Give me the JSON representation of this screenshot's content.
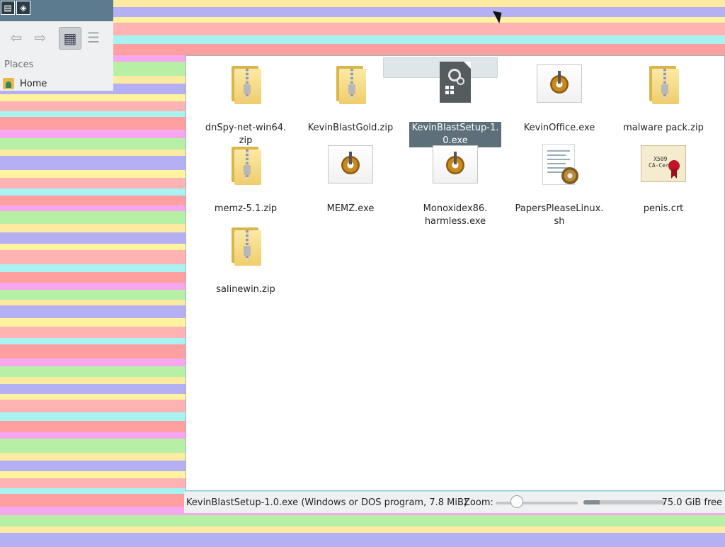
{
  "colors": {
    "stripes": [
      "#fbea9f",
      "#ffb3b3",
      "#f7a6f0",
      "#b5b0f3",
      "#a8f2f2",
      "#b6f0a5",
      "#fff3a0",
      "#ff9fa0"
    ]
  },
  "sidebar": {
    "places_label": "Places",
    "items": [
      {
        "label": "Home",
        "icon": "home-folder-icon"
      }
    ]
  },
  "toolbar": {
    "buttons": [
      {
        "name": "back",
        "icon": "arrow-left-icon"
      },
      {
        "name": "forward",
        "icon": "arrow-right-icon"
      },
      {
        "name": "icons-view",
        "icon": "icons-view-icon",
        "active": true
      },
      {
        "name": "details-view",
        "icon": "details-view-icon"
      }
    ]
  },
  "files": [
    {
      "name": "dnSpy-net-win64.\nzip",
      "type": "zip"
    },
    {
      "name": "KevinBlastGold.zip",
      "type": "zip"
    },
    {
      "name": "KevinBlastSetup-1.\n0.exe",
      "type": "setup",
      "selected": true
    },
    {
      "name": "KevinOffice.exe",
      "type": "exe"
    },
    {
      "name": "malware pack.zip",
      "type": "zip"
    },
    {
      "name": "memz-5.1.zip",
      "type": "zip"
    },
    {
      "name": "MEMZ.exe",
      "type": "exe"
    },
    {
      "name": "Monoxidex86.\nharmless.exe",
      "type": "exe"
    },
    {
      "name": "PapersPleaseLinux.\nsh",
      "type": "sh"
    },
    {
      "name": "penis.crt",
      "type": "crt"
    },
    {
      "name": "salinewin.zip",
      "type": "zip"
    }
  ],
  "certificate_icon_text": "X509\nCA-Cert",
  "status": {
    "selection_text": "KevinBlastSetup-1.0.exe (Windows or DOS program, 7.8 MiB)",
    "zoom_label": "Zoom:",
    "zoom_level": 0.25,
    "disk_used_fraction": 0.2,
    "free_space": "75.0 GiB free"
  }
}
